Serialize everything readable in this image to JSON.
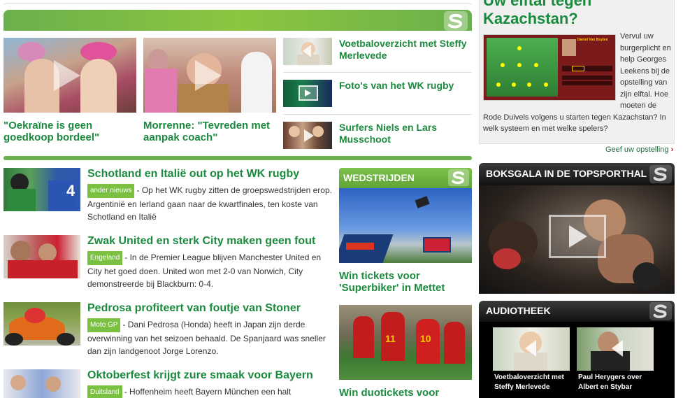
{
  "sidebar_poll": {
    "title": "Uw elftal tegen\nKazachstan?",
    "text": "Vervul uw burgerplicht en help Georges Leekens bij de opstelling van zijn elftal. Hoe moeten de Rode Duivels volgens u starten tegen Kazachstan? In welk systeem en met welke spelers?",
    "cta": "Geef uw opstelling",
    "game_player": "Daniel Van Buyten"
  },
  "video_top": [
    {
      "caption": "\"Oekraïne is geen goedkoop bordeel\""
    },
    {
      "caption": "Morrenne: \"Tevreden met aanpak coach\""
    }
  ],
  "media_list": [
    {
      "title": "Voetbaloverzicht met Steffy Merlevede",
      "type": "audio"
    },
    {
      "title": "Foto's van het WK rugby",
      "type": "photo"
    },
    {
      "title": "Surfers Niels en Lars Musschoot",
      "type": "video"
    }
  ],
  "news": [
    {
      "title": "Schotland en Italië out op het WK rugby",
      "badge": "ander nieuws",
      "text": "- Op het WK rugby zitten de groepswedstrijden erop. Argentinië en Ierland gaan naar de kwartfinales, ten koste van Schotland en Italië"
    },
    {
      "title": "Zwak United en sterk City maken geen fout",
      "badge": "Engeland",
      "text": "- In de Premier League blijven Manchester United en City het goed doen. United won met 2-0 van Norwich, City demonstreerde bij Blackburn: 0-4."
    },
    {
      "title": "Pedrosa profiteert van foutje van Stoner",
      "badge": "Moto GP",
      "text": "- Dani Pedrosa (Honda) heeft in Japan zijn derde overwinning van het seizoen behaald. De Spanjaard was sneller dan zijn landgenoot Jorge Lorenzo."
    },
    {
      "title": "Oktoberfest krijgt zure smaak voor Bayern",
      "badge": "Duitsland",
      "text": "- Hoffenheim heeft Bayern München een halt"
    }
  ],
  "wedstrijden": {
    "header": "WEDSTRIJDEN",
    "items": [
      {
        "title": "Win tickets voor 'Superbiker' in Mettet"
      },
      {
        "title": "Win duotickets voor"
      }
    ]
  },
  "boksgala": {
    "header": "BOKSGALA IN DE TOPSPORTHAL"
  },
  "audiotheek": {
    "header": "AUDIOTHEEK",
    "items": [
      {
        "title": "Voetbaloverzicht met Steffy Merlevede"
      },
      {
        "title": "Paul Herygers over Albert en Stybar"
      }
    ]
  },
  "colors": {
    "accent": "#1b8a3e",
    "badge": "#7ac142",
    "bar": "#8cc63f",
    "cta_arrow": "#d0021b"
  },
  "icons": [
    "play-icon",
    "photo-icon",
    "audio-icon",
    "sporza-logo-icon",
    "chevron-right-icon"
  ]
}
